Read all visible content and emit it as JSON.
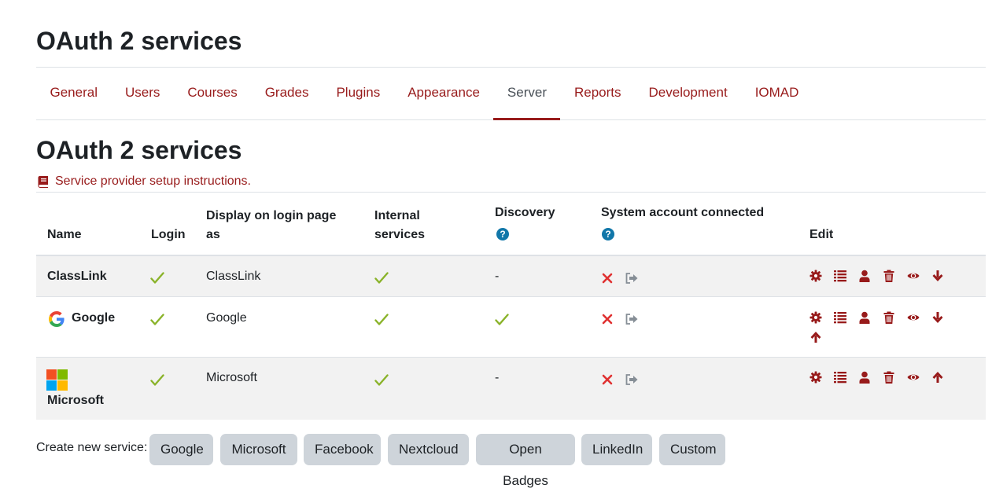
{
  "page": {
    "title": "OAuth 2 services"
  },
  "nav": {
    "tabs": [
      {
        "label": "General"
      },
      {
        "label": "Users"
      },
      {
        "label": "Courses"
      },
      {
        "label": "Grades"
      },
      {
        "label": "Plugins"
      },
      {
        "label": "Appearance"
      },
      {
        "label": "Server",
        "active": true
      },
      {
        "label": "Reports"
      },
      {
        "label": "Development"
      },
      {
        "label": "IOMAD"
      }
    ]
  },
  "section": {
    "title": "OAuth 2 services",
    "help_link": "Service provider setup instructions."
  },
  "table": {
    "headers": {
      "name": "Name",
      "login": "Login",
      "display_line1": "Display on login page",
      "display_line2": "as",
      "internal_line1": "Internal",
      "internal_line2": "services",
      "discovery": "Discovery",
      "discovery_help": "?",
      "system_account": "System account connected",
      "system_account_help": "?",
      "edit": "Edit"
    },
    "rows": [
      {
        "name": "ClassLink",
        "display_as": "ClassLink",
        "discovery": "-"
      },
      {
        "name": "Google",
        "display_as": "Google",
        "discovery": ""
      },
      {
        "name": "Microsoft",
        "display_as": "Microsoft",
        "discovery": "-"
      }
    ]
  },
  "create": {
    "label": "Create new service:",
    "buttons": [
      "Google",
      "Microsoft",
      "Facebook",
      "Nextcloud",
      "Open Badges",
      "LinkedIn",
      "Custom"
    ]
  },
  "colors": {
    "brand": "#981b1b",
    "check": "#8ab32a",
    "x": "#e03131",
    "button_bg": "#ced4da"
  },
  "icons": {
    "help_link": "book-icon",
    "actions": [
      "gear-icon",
      "list-icon",
      "user-icon",
      "trash-icon",
      "eye-icon",
      "arrow-down-icon",
      "arrow-up-icon"
    ]
  }
}
